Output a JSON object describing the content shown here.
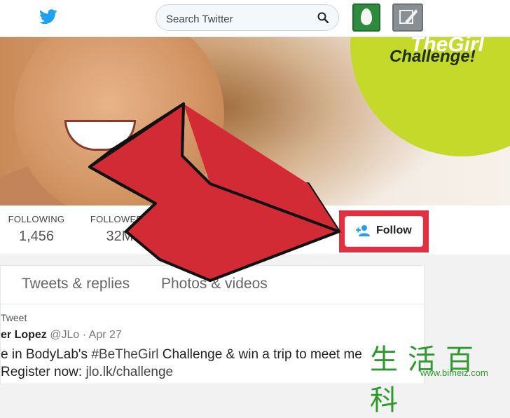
{
  "header": {
    "search_placeholder": "Search Twitter",
    "brand_color": "#1da1f2"
  },
  "banner": {
    "promo_line1": "TheGirl",
    "promo_line2": "Challenge!"
  },
  "stats": [
    {
      "label": "FOLLOWING",
      "value": "1,456"
    },
    {
      "label": "FOLLOWERS",
      "value": "32M"
    }
  ],
  "follow_button": {
    "label": "Follow",
    "highlight_color": "#e23040"
  },
  "tabs": [
    {
      "label": "Tweets & replies"
    },
    {
      "label": "Photos & videos"
    }
  ],
  "tweet": {
    "retweet_label": "Tweet",
    "author_name": "er Lopez",
    "author_handle": "@JLo",
    "separator": "·",
    "date": "Apr 27",
    "line1_prefix": "e in BodyLab's ",
    "line1_hashtag": "#BeTheGirl",
    "line1_suffix": " Challenge & win a trip to meet me",
    "line2_prefix": "Register now: ",
    "line2_link": "jlo.lk/challenge"
  },
  "watermark": {
    "text": "生活百科",
    "url": "www.bimeiz.com"
  }
}
